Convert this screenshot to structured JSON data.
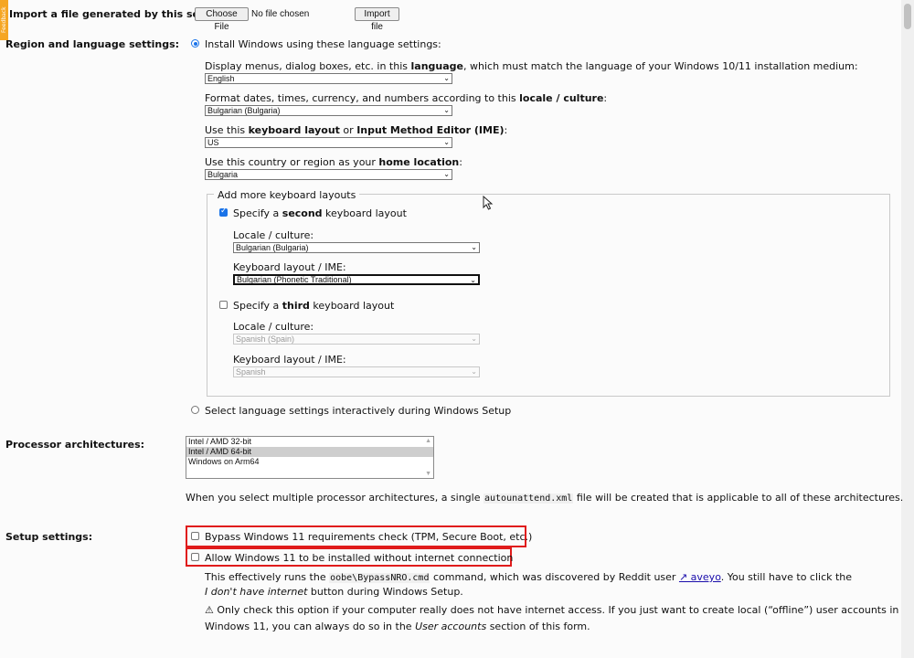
{
  "import": {
    "label": "Import a file generated by this service:",
    "choose_button": "Choose File",
    "file_status": "No file chosen",
    "import_button": "Import file"
  },
  "feedback_tab": "Feedback",
  "region": {
    "label": "Region and language settings:",
    "install_option": "Install Windows using these language settings:",
    "display_pre": "Display menus, dialog boxes, etc. in this ",
    "display_bold": "language",
    "display_post": ", which must match the language of your Windows 10/11 installation medium:",
    "display_value": "English",
    "format_pre": "Format dates, times, currency, and numbers according to this ",
    "format_bold": "locale / culture",
    "format_post": ":",
    "format_value": "Bulgarian (Bulgaria)",
    "keyboard_pre": "Use this ",
    "keyboard_bold1": "keyboard layout",
    "keyboard_mid": " or ",
    "keyboard_bold2": "Input Method Editor (IME)",
    "keyboard_post": ":",
    "keyboard_value": "US",
    "home_pre": "Use this country or region as your ",
    "home_bold": "home location",
    "home_post": ":",
    "home_value": "Bulgaria",
    "more_layouts_legend": "Add more keyboard layouts",
    "second_pre": "Specify a ",
    "second_bold": "second",
    "second_post": " keyboard layout",
    "second_locale_label": "Locale / culture:",
    "second_locale_value": "Bulgarian (Bulgaria)",
    "second_layout_label": "Keyboard layout / IME:",
    "second_layout_value": "Bulgarian (Phonetic Traditional)",
    "third_pre": "Specify a ",
    "third_bold": "third",
    "third_post": " keyboard layout",
    "third_locale_label": "Locale / culture:",
    "third_locale_value": "Spanish (Spain)",
    "third_layout_label": "Keyboard layout / IME:",
    "third_layout_value": "Spanish",
    "interactive_option": "Select language settings interactively during Windows Setup"
  },
  "processor": {
    "label": "Processor architectures:",
    "options": [
      "Intel / AMD 32-bit",
      "Intel / AMD 64-bit",
      "Windows on Arm64"
    ],
    "note_pre": "When you select multiple processor architectures, a single ",
    "note_code": "autounattend.xml",
    "note_post": " file will be created that is applicable to all of these architectures."
  },
  "setup": {
    "label": "Setup settings:",
    "bypass_check": "Bypass Windows 11 requirements check (TPM, Secure Boot, etc.)",
    "no_internet": "Allow Windows 11 to be installed without internet connection",
    "info1_pre": "This effectively runs the ",
    "info1_code": "oobe\\BypassNRO.cmd",
    "info1_mid": " command, which was discovered by Reddit user ",
    "info1_link": "↗ aveyo",
    "info1_post": ". You still have to click the",
    "info2_italic": "I don't have internet",
    "info2_post": " button during Windows Setup.",
    "warn_icon": "⚠",
    "warn1": " Only check this option if your computer really does not have internet access. If you just want to create local (“offline”) user accounts in",
    "warn2_pre": "Windows 11, you can always do so in the ",
    "warn2_italic": "User accounts",
    "warn2_post": " section of this form."
  }
}
